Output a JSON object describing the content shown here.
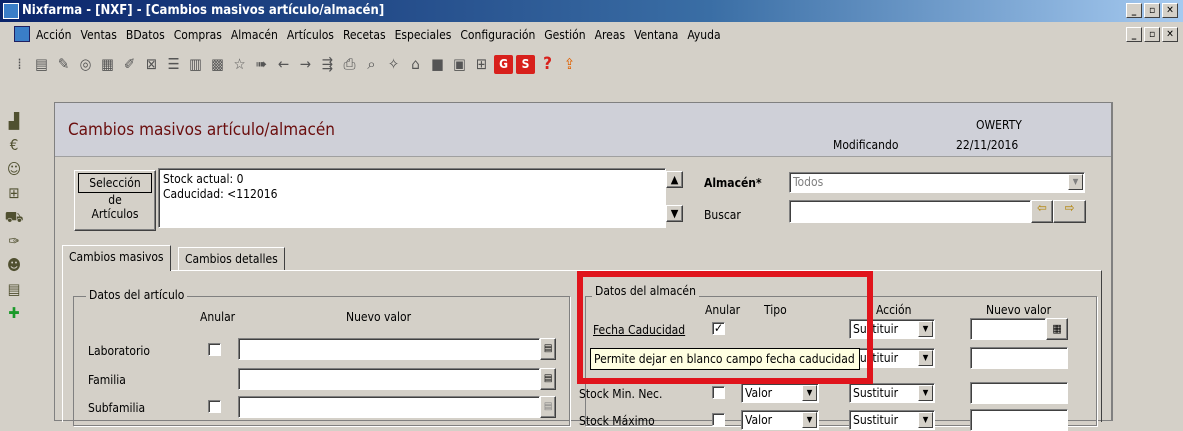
{
  "window": {
    "title": "Nixfarma - [NXF] - [Cambios masivos artículo/almacén]"
  },
  "menu": [
    "Acción",
    "Ventas",
    "BDatos",
    "Compras",
    "Almacén",
    "Artículos",
    "Recetas",
    "Especiales",
    "Configuración",
    "Gestión",
    "Areas",
    "Ventana",
    "Ayuda"
  ],
  "toolbar": {
    "g_label": "G",
    "s_label": "S",
    "help_label": "?"
  },
  "header": {
    "title": "Cambios masivos artículo/almacén",
    "mode": "Modificando",
    "user": "OWERTY",
    "date": "22/11/2016"
  },
  "selection": {
    "btn_line1": "Selección",
    "btn_line2": "de",
    "btn_line3": "Artículos",
    "text_line1": "Stock actual: 0",
    "text_line2": "Caducidad: <112016"
  },
  "almacen": {
    "label": "Almacén*",
    "value": "Todos",
    "buscar_label": "Buscar",
    "buscar_value": ""
  },
  "tabs": [
    "Cambios masivos",
    "Cambios detalles"
  ],
  "articulo": {
    "group_title": "Datos del artículo",
    "col_anular": "Anular",
    "col_nuevo": "Nuevo valor",
    "rows": [
      "Laboratorio",
      "Familia",
      "Subfamilia"
    ]
  },
  "almacen_data": {
    "group_title": "Datos del almacén",
    "col_anular": "Anular",
    "col_tipo": "Tipo",
    "col_accion": "Acción",
    "col_nuevo": "Nuevo valor",
    "rows": [
      {
        "label": "Fecha Caducidad",
        "tipo": "",
        "accion": "Sustituir"
      },
      {
        "label": "",
        "tipo": "",
        "accion": "Sustituir"
      },
      {
        "label": "Stock Min. Nec.",
        "tipo": "Valor",
        "accion": "Sustituir"
      },
      {
        "label": "Stock Máximo",
        "tipo": "Valor",
        "accion": "Sustituir"
      }
    ]
  },
  "tooltip": "Permite dejar en blanco campo fecha caducidad",
  "highlight_color": "#e0141c"
}
